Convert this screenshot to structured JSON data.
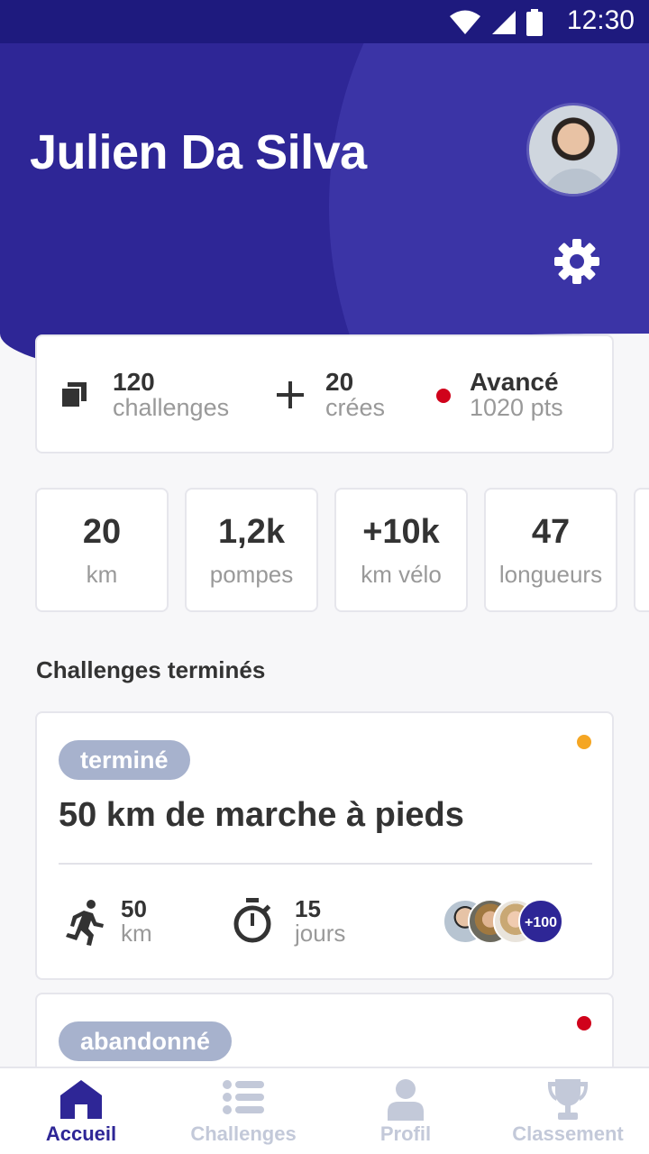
{
  "status_bar": {
    "time": "12:30"
  },
  "profile": {
    "name": "Julien Da Silva"
  },
  "summary": {
    "challenges": {
      "value": "120",
      "label": "challenges"
    },
    "created": {
      "value": "20",
      "label": "crées"
    },
    "level": {
      "value": "Avancé",
      "label": "1020 pts",
      "dot_color": "#d0021b"
    }
  },
  "metrics": [
    {
      "value": "20",
      "unit": "km"
    },
    {
      "value": "1,2k",
      "unit": "pompes"
    },
    {
      "value": "+10k",
      "unit": "km vélo"
    },
    {
      "value": "47",
      "unit": "longueurs"
    }
  ],
  "section_title": "Challenges terminés",
  "challenges": [
    {
      "status": "terminé",
      "status_dot": "#f5a623",
      "title": "50 km de marche à pieds",
      "distance": {
        "value": "50",
        "unit": "km"
      },
      "duration": {
        "value": "15",
        "unit": "jours"
      },
      "participants_more": "+100"
    },
    {
      "status": "abandonné",
      "status_dot": "#d0021b"
    }
  ],
  "nav": [
    {
      "label": "Accueil",
      "icon": "home-icon",
      "active": true
    },
    {
      "label": "Challenges",
      "icon": "list-icon",
      "active": false
    },
    {
      "label": "Profil",
      "icon": "user-icon",
      "active": false
    },
    {
      "label": "Classement",
      "icon": "trophy-icon",
      "active": false
    }
  ],
  "colors": {
    "primary": "#2e2696",
    "accent": "#3b34a6",
    "muted": "#c3c9d9"
  }
}
